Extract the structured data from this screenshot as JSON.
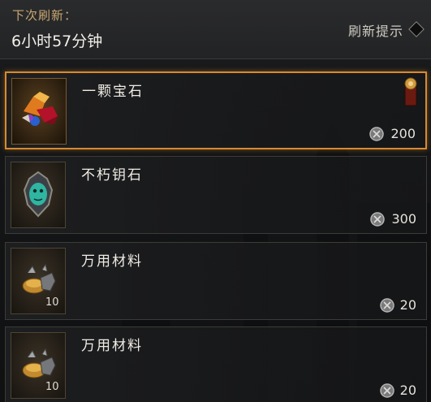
{
  "header": {
    "next_refresh_label": "下次刷新：",
    "timer": "6小时57分钟",
    "refresh_hint": "刷新提示"
  },
  "items": [
    {
      "name": "一颗宝石",
      "price": "200",
      "quantity": "",
      "selected": true,
      "icon": "gem-cluster-icon"
    },
    {
      "name": "不朽钥石",
      "price": "300",
      "quantity": "",
      "selected": false,
      "icon": "keystone-icon"
    },
    {
      "name": "万用材料",
      "price": "20",
      "quantity": "10",
      "selected": false,
      "icon": "crafting-material-icon"
    },
    {
      "name": "万用材料",
      "price": "20",
      "quantity": "10",
      "selected": false,
      "icon": "crafting-material-icon"
    }
  ],
  "colors": {
    "accent": "#d88a2e",
    "label_gold": "#c9a872"
  }
}
